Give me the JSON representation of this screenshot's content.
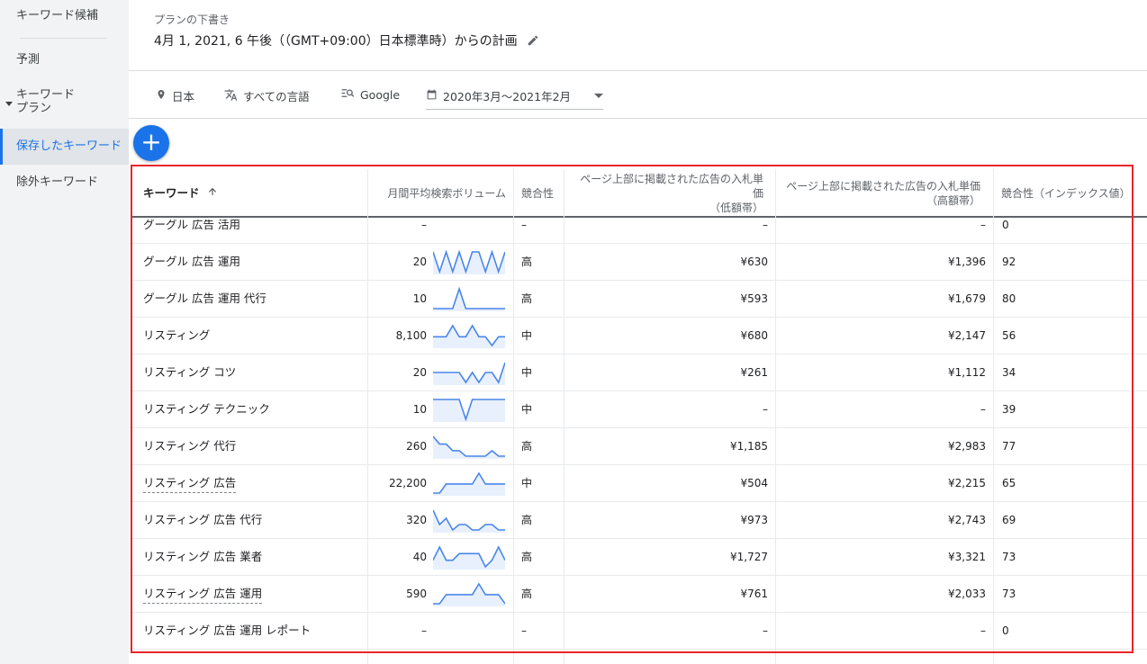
{
  "sidebar": {
    "items": [
      {
        "label": "キーワード候補"
      },
      {
        "label": "予測"
      },
      {
        "label": "キーワード\nプラン"
      },
      {
        "label": "保存したキーワード"
      },
      {
        "label": "除外キーワード"
      }
    ]
  },
  "header": {
    "draft_label": "プランの下書き",
    "title": "4月 1, 2021, 6 午後（（GMT+09:00）日本標準時）からの計画"
  },
  "filters": {
    "location": "日本",
    "language": "すべての言語",
    "network": "Google",
    "date_range": "2020年3月～2021年2月"
  },
  "add_button_label": "+",
  "table": {
    "columns": {
      "keyword": "キーワード",
      "volume": "月間平均検索ボリューム",
      "competition": "競合性",
      "bid_low": "ページ上部に掲載された広告の入札単価\n（低額帯）",
      "bid_high": "ページ上部に掲載された広告の入札単価\n（高額帯）",
      "competition_index": "競合性（インデックス値）"
    },
    "rows": [
      {
        "keyword": "グーグル 広告 活用",
        "volume": "–",
        "competition": "–",
        "bid_low": "–",
        "bid_high": "–",
        "index": "0",
        "dashed": false,
        "trend": []
      },
      {
        "keyword": "グーグル 広告 運用",
        "volume": "20",
        "competition": "高",
        "bid_low": "¥630",
        "bid_high": "¥1,396",
        "index": "92",
        "dashed": false,
        "trend": [
          20,
          10,
          20,
          10,
          20,
          10,
          20,
          20,
          10,
          20,
          10,
          20
        ]
      },
      {
        "keyword": "グーグル 広告 運用 代行",
        "volume": "10",
        "competition": "高",
        "bid_low": "¥593",
        "bid_high": "¥1,679",
        "index": "80",
        "dashed": false,
        "trend": [
          10,
          10,
          10,
          10,
          20,
          10,
          10,
          10,
          10,
          10,
          10,
          10
        ]
      },
      {
        "keyword": "リスティング",
        "volume": "8,100",
        "competition": "中",
        "bid_low": "¥680",
        "bid_high": "¥2,147",
        "index": "56",
        "dashed": false,
        "trend": [
          8100,
          8100,
          8100,
          10000,
          8100,
          8100,
          10000,
          8100,
          8100,
          6600,
          8100,
          8100
        ]
      },
      {
        "keyword": "リスティング コツ",
        "volume": "20",
        "competition": "中",
        "bid_low": "¥261",
        "bid_high": "¥1,112",
        "index": "34",
        "dashed": false,
        "trend": [
          20,
          20,
          20,
          20,
          20,
          10,
          20,
          10,
          20,
          20,
          10,
          30
        ]
      },
      {
        "keyword": "リスティング テクニック",
        "volume": "10",
        "competition": "中",
        "bid_low": "–",
        "bid_high": "–",
        "index": "39",
        "dashed": false,
        "trend": [
          10,
          10,
          10,
          10,
          10,
          0,
          10,
          10,
          10,
          10,
          10,
          10
        ]
      },
      {
        "keyword": "リスティング 代行",
        "volume": "260",
        "competition": "高",
        "bid_low": "¥1,185",
        "bid_high": "¥2,983",
        "index": "77",
        "dashed": false,
        "trend": [
          390,
          320,
          320,
          260,
          260,
          210,
          210,
          210,
          210,
          260,
          210,
          210
        ]
      },
      {
        "keyword": "リスティング 広告",
        "volume": "22,200",
        "competition": "中",
        "bid_low": "¥504",
        "bid_high": "¥2,215",
        "index": "65",
        "dashed": true,
        "trend": [
          18100,
          18100,
          22200,
          22200,
          22200,
          22200,
          22200,
          27100,
          22200,
          22200,
          22200,
          22200
        ]
      },
      {
        "keyword": "リスティング 広告 代行",
        "volume": "320",
        "competition": "高",
        "bid_low": "¥973",
        "bid_high": "¥2,743",
        "index": "69",
        "dashed": false,
        "trend": [
          480,
          320,
          390,
          260,
          320,
          320,
          260,
          260,
          320,
          320,
          260,
          260
        ]
      },
      {
        "keyword": "リスティング 広告 業者",
        "volume": "40",
        "competition": "高",
        "bid_low": "¥1,727",
        "bid_high": "¥3,321",
        "index": "73",
        "dashed": false,
        "trend": [
          30,
          50,
          30,
          30,
          40,
          40,
          40,
          40,
          20,
          30,
          50,
          30
        ]
      },
      {
        "keyword": "リスティング 広告 運用",
        "volume": "590",
        "competition": "高",
        "bid_low": "¥761",
        "bid_high": "¥2,033",
        "index": "73",
        "dashed": true,
        "trend": [
          480,
          480,
          590,
          590,
          590,
          590,
          590,
          720,
          590,
          590,
          590,
          480
        ]
      },
      {
        "keyword": "リスティング 広告 運用 レポート",
        "volume": "–",
        "competition": "–",
        "bid_low": "–",
        "bid_high": "–",
        "index": "0",
        "dashed": false,
        "trend": []
      }
    ]
  },
  "colors": {
    "accent": "#1a73e8",
    "highlight_box": "#e8262a",
    "sparkline": "#4a86e8",
    "sparkline_fill": "#e8f0fe"
  }
}
